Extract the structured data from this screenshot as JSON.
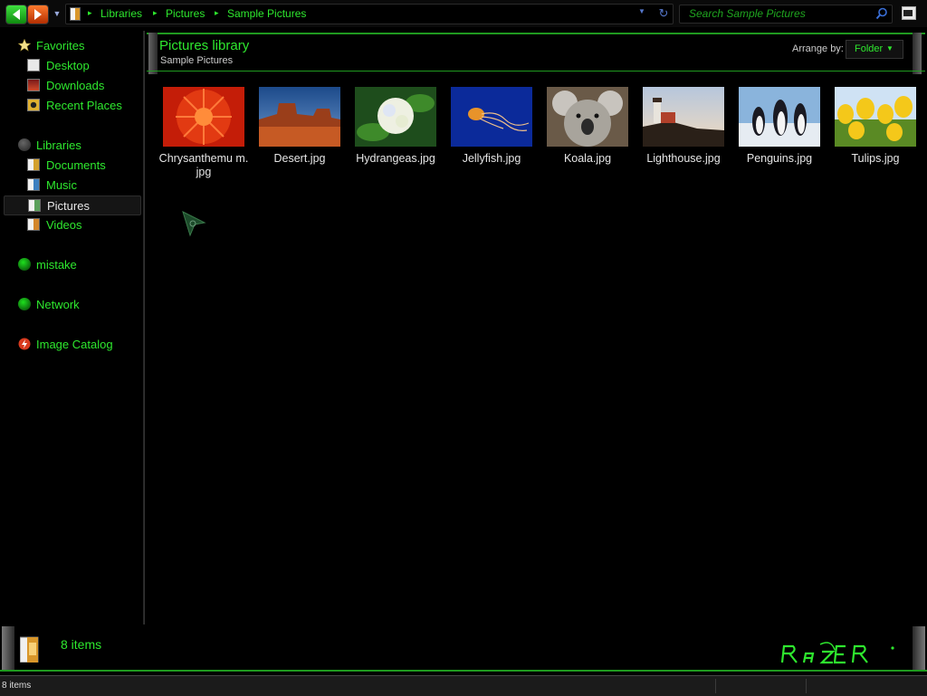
{
  "toolbar": {
    "breadcrumbs": [
      "Libraries",
      "Pictures",
      "Sample Pictures"
    ],
    "search_placeholder": "Search Sample Pictures"
  },
  "nav": {
    "favorites": {
      "label": "Favorites",
      "icon": "star-icon",
      "items": [
        {
          "label": "Desktop",
          "icon": "desktop-icon"
        },
        {
          "label": "Downloads",
          "icon": "downloads-icon"
        },
        {
          "label": "Recent Places",
          "icon": "recent-places-icon"
        }
      ]
    },
    "libraries": {
      "label": "Libraries",
      "icon": "libraries-icon",
      "items": [
        {
          "label": "Documents",
          "icon": "documents-icon"
        },
        {
          "label": "Music",
          "icon": "music-icon"
        },
        {
          "label": "Pictures",
          "icon": "pictures-icon",
          "selected": true
        },
        {
          "label": "Videos",
          "icon": "videos-icon"
        }
      ]
    },
    "homegroup": {
      "label": "mistake",
      "icon": "user-globe-icon"
    },
    "network": {
      "label": "Network",
      "icon": "network-globe-icon"
    },
    "catalog": {
      "label": "Image Catalog",
      "icon": "image-catalog-icon"
    }
  },
  "header": {
    "title": "Pictures library",
    "subtitle": "Sample Pictures",
    "arrange_label": "Arrange by:",
    "arrange_value": "Folder"
  },
  "files": [
    {
      "name": "Chrysanthemum.jpg",
      "display": "Chrysanthemu m.jpg"
    },
    {
      "name": "Desert.jpg",
      "display": "Desert.jpg"
    },
    {
      "name": "Hydrangeas.jpg",
      "display": "Hydrangeas.jpg"
    },
    {
      "name": "Jellyfish.jpg",
      "display": "Jellyfish.jpg"
    },
    {
      "name": "Koala.jpg",
      "display": "Koala.jpg"
    },
    {
      "name": "Lighthouse.jpg",
      "display": "Lighthouse.jpg"
    },
    {
      "name": "Penguins.jpg",
      "display": "Penguins.jpg"
    },
    {
      "name": "Tulips.jpg",
      "display": "Tulips.jpg"
    }
  ],
  "details": {
    "count": "8 items"
  },
  "statusbar": {
    "text": "8 items"
  },
  "colors": {
    "accent": "#2ee82e",
    "background": "#000000",
    "text_light": "#e6e6e6"
  }
}
